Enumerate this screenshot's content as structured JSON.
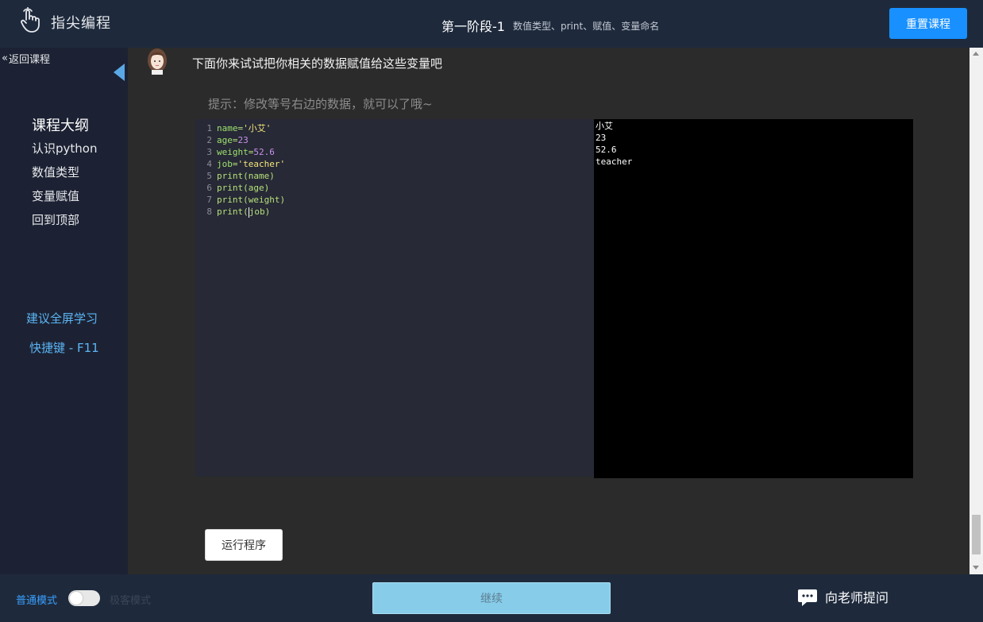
{
  "header": {
    "logo_text": "指尖编程",
    "stage_title": "第一阶段-1",
    "stage_subtitle": "数值类型、print、赋值、变量命名",
    "reset_label": "重置课程"
  },
  "sidebar": {
    "back_label": "返回课程",
    "outline_title": "课程大纲",
    "items": [
      {
        "label": "认识python"
      },
      {
        "label": "数值类型"
      },
      {
        "label": "变量赋值"
      },
      {
        "label": "回到顶部"
      }
    ],
    "fullscreen_tip": "建议全屏学习",
    "hotkey_tip": "快捷键 - F11"
  },
  "main": {
    "instruction": "下面你来试试把你相关的数据赋值给这些变量吧",
    "hint": "提示：修改等号右边的数据，就可以了哦~",
    "code_lines": [
      {
        "no": "1",
        "tokens": [
          {
            "t": "name",
            "c": "var"
          },
          {
            "t": "=",
            "c": "op"
          },
          {
            "t": "'小艾'",
            "c": "str"
          }
        ]
      },
      {
        "no": "2",
        "tokens": [
          {
            "t": "age",
            "c": "var"
          },
          {
            "t": "=",
            "c": "op"
          },
          {
            "t": "23",
            "c": "num"
          }
        ]
      },
      {
        "no": "3",
        "tokens": [
          {
            "t": "weight",
            "c": "var"
          },
          {
            "t": "=",
            "c": "op"
          },
          {
            "t": "52.6",
            "c": "num"
          }
        ]
      },
      {
        "no": "4",
        "tokens": [
          {
            "t": "job",
            "c": "var"
          },
          {
            "t": "=",
            "c": "op"
          },
          {
            "t": "'teacher'",
            "c": "str"
          }
        ]
      },
      {
        "no": "5",
        "tokens": [
          {
            "t": "print(name)",
            "c": "fn"
          }
        ]
      },
      {
        "no": "6",
        "tokens": [
          {
            "t": "print(age)",
            "c": "fn"
          }
        ]
      },
      {
        "no": "7",
        "tokens": [
          {
            "t": "print(weight)",
            "c": "fn"
          }
        ]
      },
      {
        "no": "8",
        "tokens": [
          {
            "t": "print(job)",
            "c": "fn"
          }
        ]
      }
    ],
    "console_output": [
      "小艾",
      "23",
      "52.6",
      "teacher"
    ],
    "run_label": "运行程序"
  },
  "footer": {
    "mode_label": "普通模式",
    "mode_label_off": "极客模式",
    "continue_label": "继续",
    "ask_teacher_label": "向老师提问"
  },
  "colors": {
    "accent": "#1890ff",
    "sidebar_bg": "#1c2233",
    "header_bg": "#1e2a3c",
    "continue_bg": "#87cdea",
    "link_blue": "#5bb5f5"
  }
}
